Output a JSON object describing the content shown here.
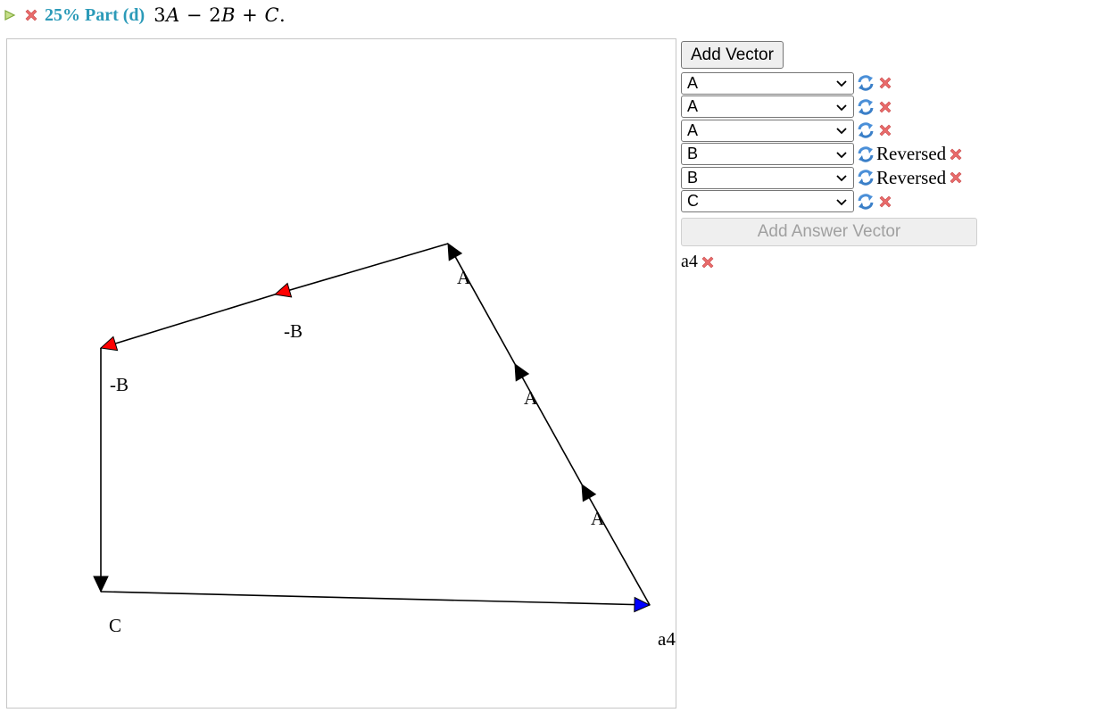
{
  "header": {
    "status_icon": "incorrect-x-icon",
    "score_label": "25% Part (d)",
    "formula_parts": [
      "3",
      "A",
      " − 2",
      "B",
      " + ",
      "C",
      "."
    ]
  },
  "colors": {
    "part_label": "#2b9ab8",
    "vector_arrow": "#000000",
    "reversed_arrow": "#ff0000",
    "answer_arrow": "#0000ff",
    "delete_icon": "#e05555",
    "refresh_icon": "#4a8fd8"
  },
  "canvas": {
    "vectors": [
      {
        "label": "A",
        "reversed": false,
        "kind": "component"
      },
      {
        "label": "A",
        "reversed": false,
        "kind": "component"
      },
      {
        "label": "A",
        "reversed": false,
        "kind": "component"
      },
      {
        "label": "-B",
        "reversed": true,
        "kind": "component"
      },
      {
        "label": "-B",
        "reversed": true,
        "kind": "component"
      },
      {
        "label": "C",
        "reversed": false,
        "kind": "component"
      }
    ],
    "answer_vector": {
      "label": "a4",
      "kind": "answer"
    }
  },
  "panel": {
    "add_vector_label": "Add Vector",
    "rows": [
      {
        "value": "A",
        "reversed_text": ""
      },
      {
        "value": "A",
        "reversed_text": ""
      },
      {
        "value": "A",
        "reversed_text": ""
      },
      {
        "value": "B",
        "reversed_text": "Reversed"
      },
      {
        "value": "B",
        "reversed_text": "Reversed"
      },
      {
        "value": "C",
        "reversed_text": ""
      }
    ],
    "add_answer_label": "Add Answer Vector",
    "add_answer_disabled": true,
    "answer_label": "a4"
  }
}
